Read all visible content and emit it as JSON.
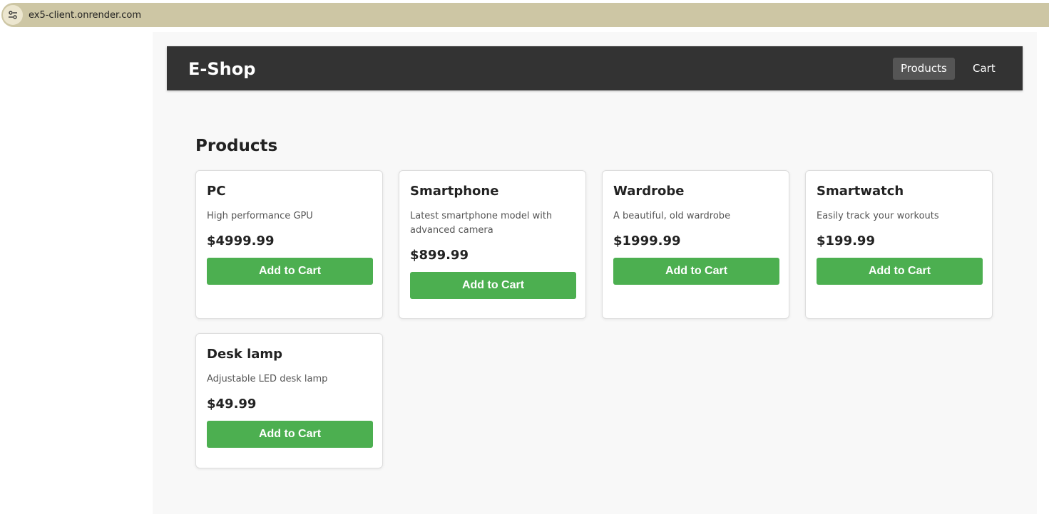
{
  "browser": {
    "url": "ex5-client.onrender.com",
    "site_info_icon": "tune-icon"
  },
  "navbar": {
    "brand": "E-Shop",
    "links": [
      {
        "label": "Products",
        "active": true
      },
      {
        "label": "Cart",
        "active": false
      }
    ]
  },
  "main": {
    "title": "Products",
    "products": [
      {
        "name": "PC",
        "description": "High performance GPU",
        "price": "$4999.99",
        "button": "Add to Cart"
      },
      {
        "name": "Smartphone",
        "description": "Latest smartphone model with advanced camera",
        "price": "$899.99",
        "button": "Add to Cart"
      },
      {
        "name": "Wardrobe",
        "description": "A beautiful, old wardrobe",
        "price": "$1999.99",
        "button": "Add to Cart"
      },
      {
        "name": "Smartwatch",
        "description": "Easily track your workouts",
        "price": "$199.99",
        "button": "Add to Cart"
      },
      {
        "name": "Desk lamp",
        "description": "Adjustable LED desk lamp",
        "price": "$49.99",
        "button": "Add to Cart"
      }
    ]
  },
  "colors": {
    "navbar_bg": "#333333",
    "active_link_bg": "#555555",
    "button_green": "#4caf50",
    "url_bar": "#cdc6a4"
  }
}
